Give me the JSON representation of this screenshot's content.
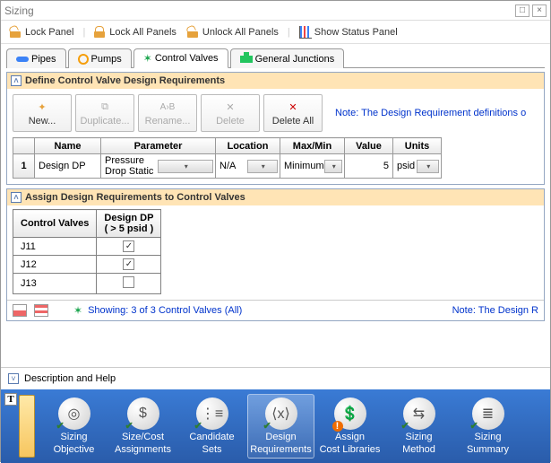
{
  "window": {
    "title": "Sizing"
  },
  "toolbar": {
    "lock_panel": "Lock Panel",
    "lock_all": "Lock All Panels",
    "unlock_all": "Unlock All Panels",
    "show_status": "Show Status Panel"
  },
  "tabs": {
    "pipes": "Pipes",
    "pumps": "Pumps",
    "control_valves": "Control Valves",
    "general_junctions": "General Junctions",
    "active": "control_valves"
  },
  "section1": {
    "title": "Define Control Valve Design Requirements",
    "buttons": {
      "new": "New...",
      "duplicate": "Duplicate...",
      "rename": "Rename...",
      "delete": "Delete",
      "delete_all": "Delete All"
    },
    "note": "Note: The Design Requirement definitions o",
    "grid": {
      "headers": {
        "name": "Name",
        "parameter": "Parameter",
        "location": "Location",
        "maxmin": "Max/Min",
        "value": "Value",
        "units": "Units"
      },
      "rows": [
        {
          "idx": "1",
          "name": "Design DP",
          "parameter": "Pressure Drop Static",
          "location": "N/A",
          "maxmin": "Minimum",
          "value": "5",
          "units": "psid"
        }
      ]
    }
  },
  "section2": {
    "title": "Assign Design Requirements to Control Valves",
    "col1": "Control Valves",
    "col2_line1": "Design DP",
    "col2_line2": "( > 5 psid )",
    "rows": [
      {
        "id": "J11",
        "checked": true
      },
      {
        "id": "J12",
        "checked": true
      },
      {
        "id": "J13",
        "checked": false
      }
    ],
    "showing": "Showing: 3 of 3 Control Valves (All)",
    "note": "Note: The Design R"
  },
  "desc": {
    "label": "Description and Help"
  },
  "ribbon": {
    "items": [
      {
        "key": "objective",
        "label1": "Sizing",
        "label2": "Objective",
        "glyph": "◎"
      },
      {
        "key": "sizecost",
        "label1": "Size/Cost",
        "label2": "Assignments",
        "glyph": "$"
      },
      {
        "key": "candidate",
        "label1": "Candidate",
        "label2": "Sets",
        "glyph": "⋮≡"
      },
      {
        "key": "design",
        "label1": "Design",
        "label2": "Requirements",
        "glyph": "⟨x⟩"
      },
      {
        "key": "assign",
        "label1": "Assign",
        "label2": "Cost Libraries",
        "glyph": "💲"
      },
      {
        "key": "method",
        "label1": "Sizing",
        "label2": "Method",
        "glyph": "⇆"
      },
      {
        "key": "summary",
        "label1": "Sizing",
        "label2": "Summary",
        "glyph": "≣"
      }
    ],
    "active": "design",
    "warn": "assign"
  }
}
